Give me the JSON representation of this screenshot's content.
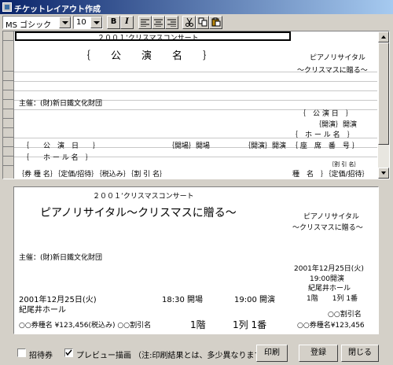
{
  "window": {
    "title": "チケットレイアウト作成"
  },
  "toolbar": {
    "font_name": "MS ゴシック",
    "font_size": "10",
    "bold_label": "B",
    "italic_label": "I",
    "align_left": "align-left-icon",
    "align_center": "align-center-icon",
    "align_right": "align-right-icon",
    "cut": "scissors-icon",
    "copy": "copy-icon",
    "paste": "paste-icon"
  },
  "layout": {
    "concert_name": "２００１’クリスマスコンサート",
    "performance_name_field": "｛　　公　　演　　名　　｝",
    "recital_title": "ピアノリサイタル",
    "recital_subtitle": "～クリスマスに贈る～",
    "organizer": "主催：(財)新日鐵文化財団",
    "field_perf_date_right": "｛　公 演 日　｝",
    "open_time_right": "｛開演｝開演",
    "field_hall_right": "｛　ホ ー ル 名　｝",
    "field_perf_date": "｛　　公　演　日　　｝",
    "open_doors_label": "｛開場｝開場",
    "start_label": "｛開演｝開演",
    "seat_number_field": "｛ 座　席　番　号 ｝",
    "field_hall": "｛　　ホ ー ル 名　｝",
    "discount_right": "｛割 引 名｝",
    "ticket_row": "｛券 種 名｝｛定価/招待｝｛税込み｝｛割 引 名｝",
    "ticket_row_right": "種　名　｝｛定価/招待｝"
  },
  "preview": {
    "concert_name": "２００１’クリスマスコンサート",
    "title_main": "ピアノリサイタル～クリスマスに贈る～",
    "recital_title": "ピアノリサイタル",
    "recital_subtitle": "～クリスマスに贈る～",
    "organizer": "主催：(財)新日鐵文化財団",
    "date_right": "2001年12月25日(火)",
    "time_right": "19:00開演",
    "hall_right": "紀尾井ホール",
    "date_left": "2001年12月25日(火)",
    "open_doors": "18:30 開場",
    "start": "19:00 開演",
    "seat_right": "1階　　1列 1番",
    "hall_left": "紀尾井ホール",
    "discount_right": "○○割引名",
    "ticket_left": "○○券種名 ¥123,456(税込み) ○○割引名",
    "floor": "1階",
    "row_seat": "1列 1番",
    "ticket_right": "○○券種名¥123,456"
  },
  "footer": {
    "invitation_label": "招待券",
    "invitation_checked": false,
    "preview_label": "プレビュー描画 （注:印刷結果とは、多少異なります）",
    "preview_checked": true,
    "print_button": "印刷",
    "register_button": "登録",
    "close_button": "閉じる"
  }
}
